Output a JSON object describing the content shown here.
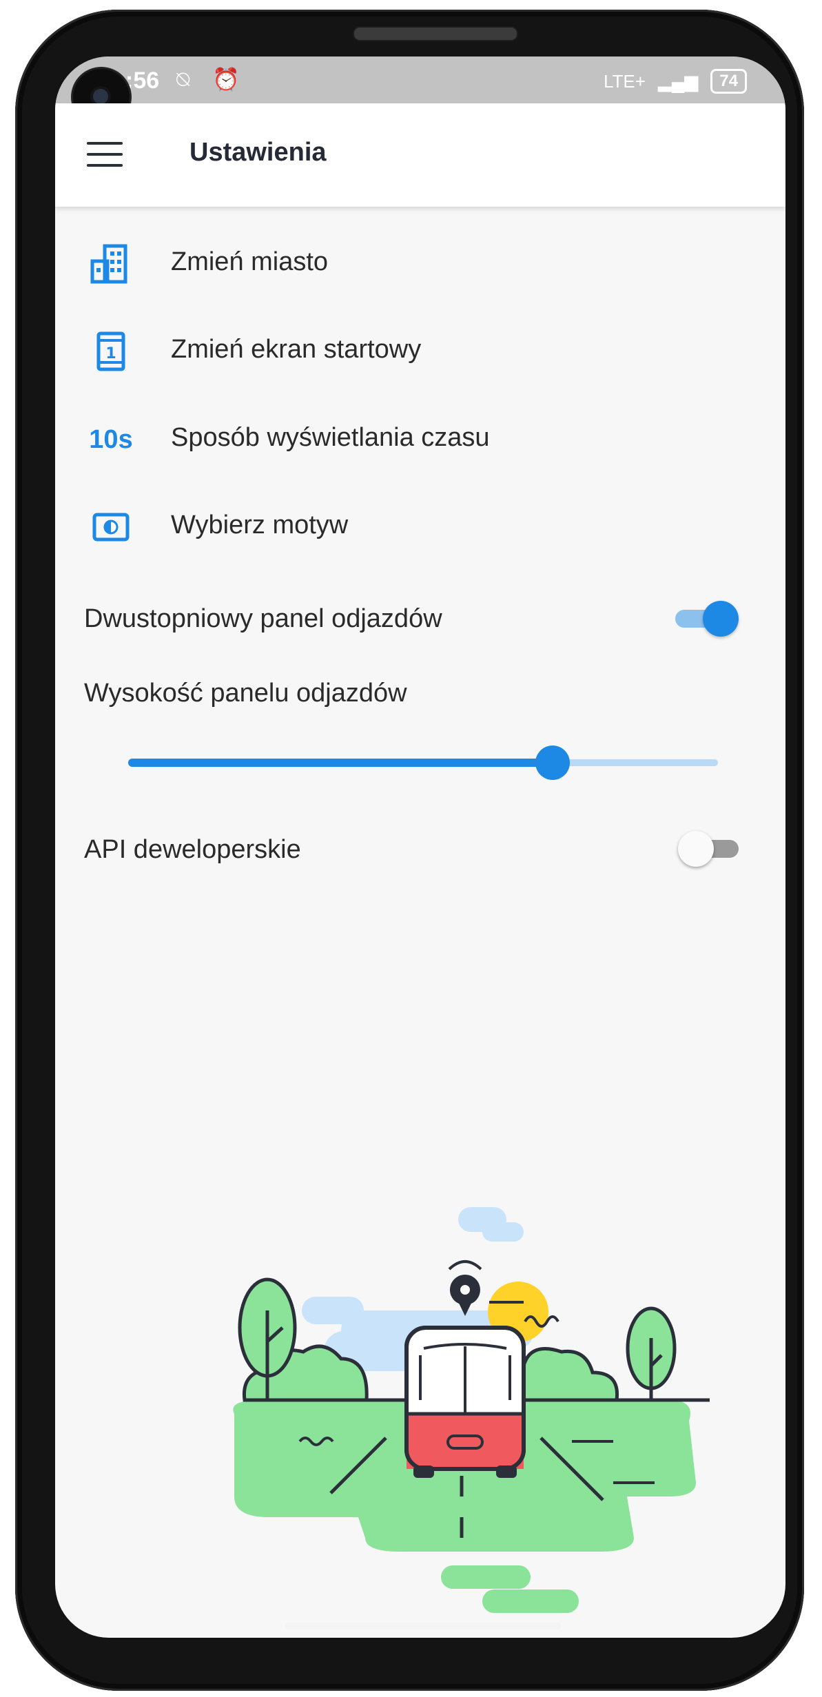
{
  "status_bar": {
    "time": ":56",
    "left_icons": "⍉ ⏰",
    "network": "LTE+",
    "battery": "74"
  },
  "app_bar": {
    "title": "Ustawienia"
  },
  "settings": {
    "items": [
      {
        "label": "Zmień miasto",
        "icon": "city-icon"
      },
      {
        "label": "Zmień ekran startowy",
        "icon": "start-screen-icon"
      },
      {
        "label": "Sposób wyświetlania czasu",
        "icon": "time-format-icon",
        "icon_text": "10s"
      },
      {
        "label": "Wybierz motyw",
        "icon": "theme-icon"
      }
    ],
    "two_stage_panel": {
      "label": "Dwustopniowy panel odjazdów",
      "enabled": true
    },
    "panel_height": {
      "label": "Wysokość panelu odjazdów",
      "value_fraction": 0.72
    },
    "developer_api": {
      "label": "API deweloperskie",
      "enabled": false
    }
  },
  "colors": {
    "accent": "#1e88e5",
    "illustration_green": "#8be39a",
    "illustration_blue": "#c9e4fa",
    "illustration_sun": "#ffd22a",
    "illustration_red": "#f05a5e"
  }
}
